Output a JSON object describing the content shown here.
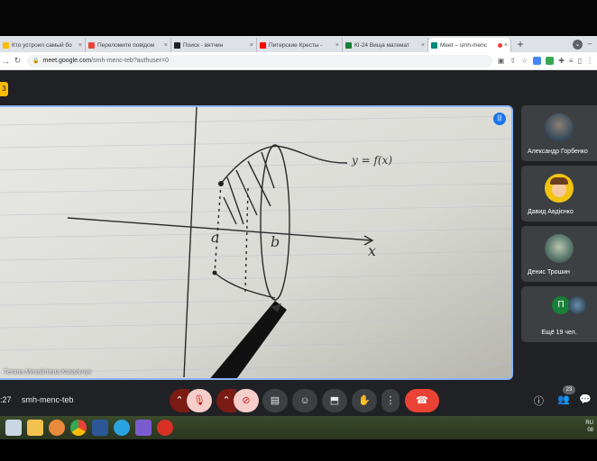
{
  "browser": {
    "tabs": [
      {
        "title": "Кто устроил самый бо",
        "favicon_color": "#fbbc04",
        "active": false
      },
      {
        "title": "Переломите повідом",
        "favicon_color": "#ea4335",
        "active": false
      },
      {
        "title": "Поиск - вятчин",
        "favicon_color": "#202124",
        "active": false
      },
      {
        "title": "Питерские Кресты - ",
        "favicon_color": "#ff0000",
        "active": false
      },
      {
        "title": "КІ-24 Вища математ",
        "favicon_color": "#188038",
        "active": false
      },
      {
        "title": "Meet – smh-menc",
        "favicon_color": "#00897b",
        "active": true
      }
    ],
    "new_tab_glyph": "+",
    "close_glyph": "×",
    "url_domain": "meet.google.com",
    "url_path": "/smh-menc-teb?authuser=0"
  },
  "meet": {
    "badge": "3",
    "main_speaker_name": "Тетяна Михайлівна Ковальчук",
    "drawing_labels": {
      "curve": "y = f(x)",
      "a": "a",
      "b": "b",
      "x_axis": "x"
    },
    "participants": [
      {
        "name": "Александр Горбенко",
        "avatar": "photo"
      },
      {
        "name": "Давид Авдієнко",
        "avatar": "cartoon"
      },
      {
        "name": "Денис Трошин",
        "avatar": "photo"
      }
    ],
    "more": {
      "label": "Ещё 19 чел.",
      "initial": "П"
    },
    "clock": ":27",
    "meeting_code": "smh-menc-teb",
    "participant_count": "23"
  },
  "taskbar": {
    "lang": "RU",
    "time_fragment": "08"
  },
  "colors": {
    "accent_blue": "#8ab4f8",
    "hangup_red": "#ea4335",
    "meet_bg": "#202124"
  }
}
